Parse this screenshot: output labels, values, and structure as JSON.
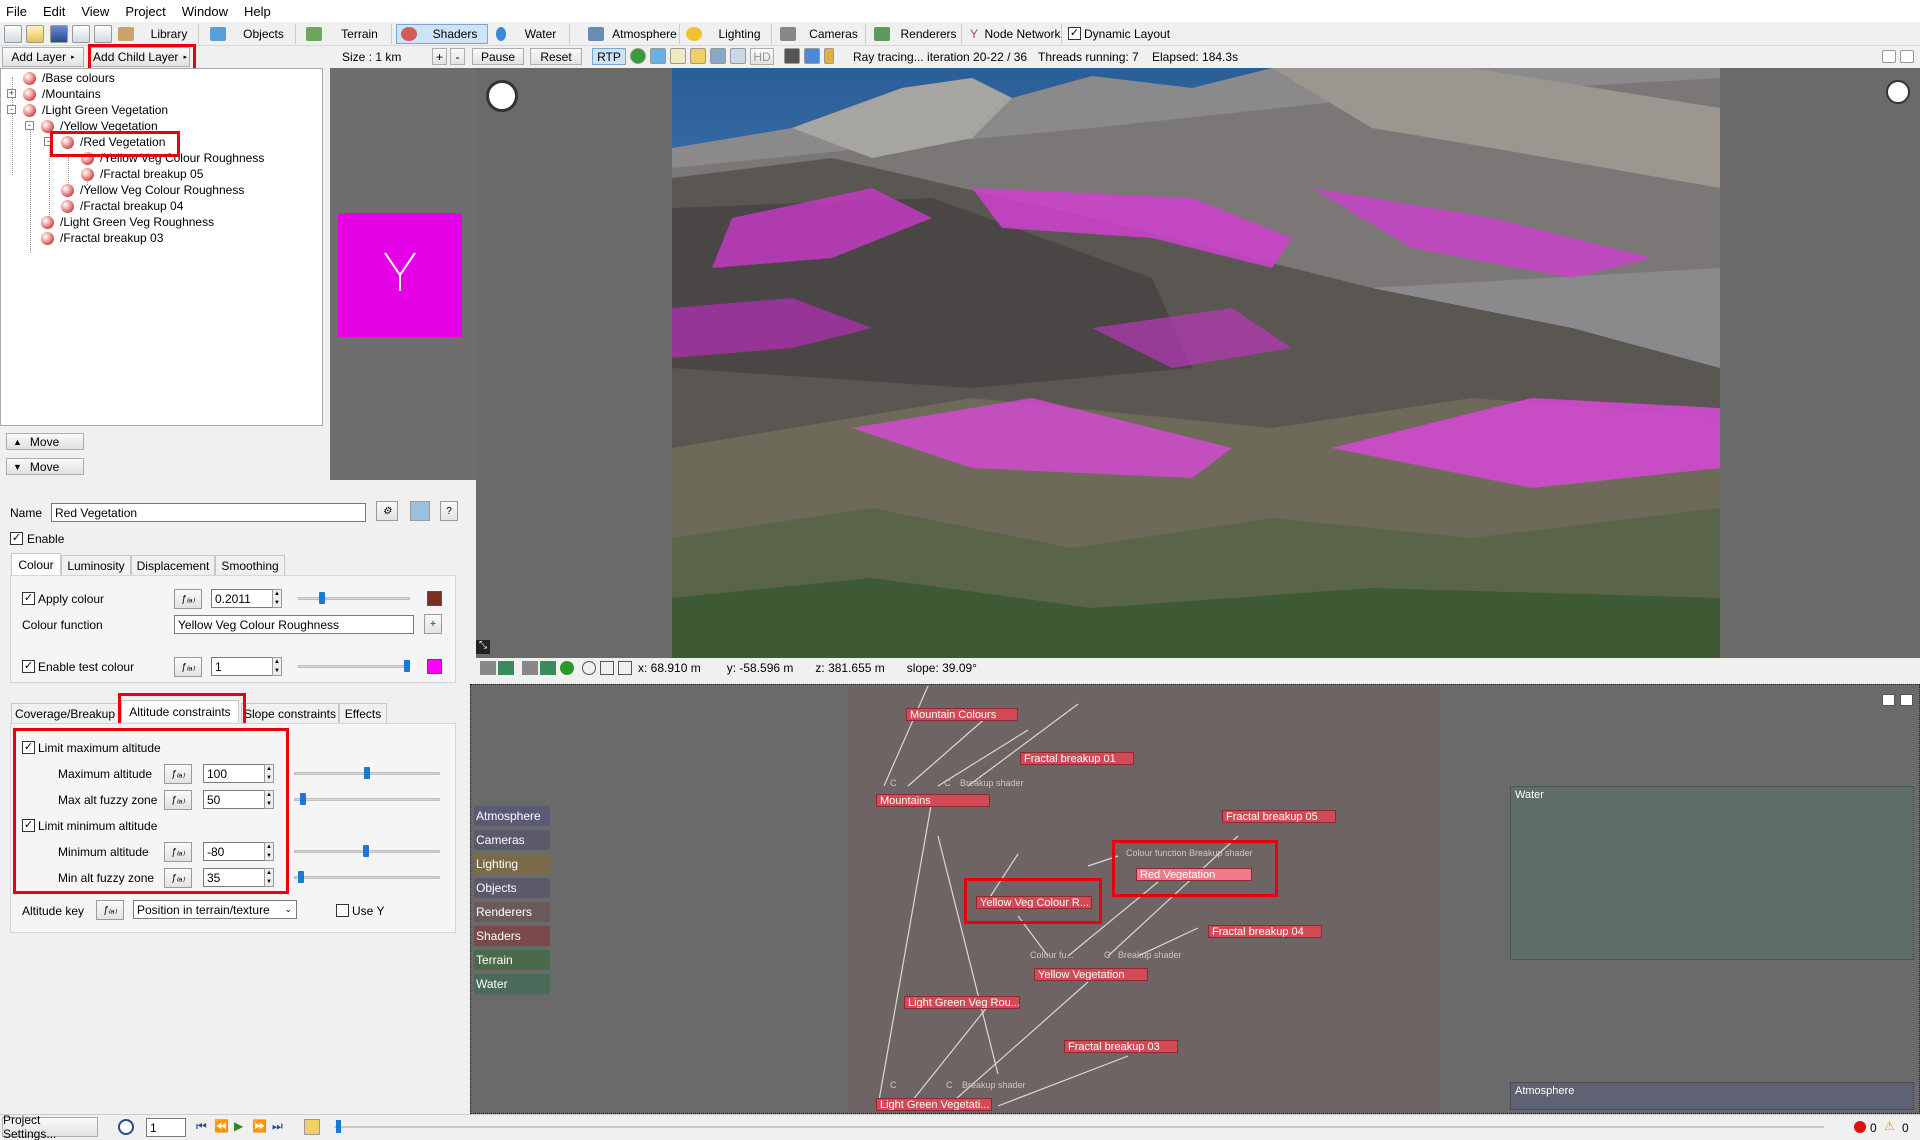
{
  "menu": [
    "File",
    "Edit",
    "View",
    "Project",
    "Window",
    "Help"
  ],
  "toolbar_tabs": [
    {
      "label": "Library",
      "icon": "library-icon",
      "color": "#c8a36a"
    },
    {
      "label": "Objects",
      "icon": "objects-icon",
      "color": "#5aa0d8"
    },
    {
      "label": "Terrain",
      "icon": "terrain-icon",
      "color": "#6aa85a"
    },
    {
      "label": "Shaders",
      "icon": "shaders-icon",
      "color": "#d45a5a"
    },
    {
      "label": "Water",
      "icon": "water-icon",
      "color": "#3a8ad8"
    },
    {
      "label": "Atmosphere",
      "icon": "atmosphere-icon",
      "color": "#6a8ab8"
    },
    {
      "label": "Lighting",
      "icon": "lighting-icon",
      "color": "#f0c030"
    },
    {
      "label": "Cameras",
      "icon": "cameras-icon",
      "color": "#888888"
    },
    {
      "label": "Renderers",
      "icon": "renderers-icon",
      "color": "#5a9a5a"
    },
    {
      "label": "Node Network",
      "icon": "node-network-icon",
      "color": "#c04040"
    }
  ],
  "dynamic_layout": {
    "label": "Dynamic Layout",
    "checked": true
  },
  "layer_toolbar": {
    "add_layer": "Add Layer",
    "add_child_layer": "Add Child Layer"
  },
  "render_toolbar": {
    "size_label": "Size : 1 km",
    "plus": "+",
    "minus": "-",
    "pause": "Pause",
    "reset": "Reset",
    "rtp": "RTP",
    "hd": "HD",
    "status": "Ray tracing... iteration 20-22 / 36",
    "threads": "Threads running: 7",
    "elapsed": "Elapsed: 184.3s"
  },
  "layer_tree": [
    {
      "label": "/Base colours"
    },
    {
      "label": "/Mountains",
      "expander": "+"
    },
    {
      "label": "/Light Green Vegetation",
      "expander": "-"
    },
    {
      "label": "/Yellow Vegetation",
      "expander": "-"
    },
    {
      "label": "/Red Vegetation",
      "expander": "-"
    },
    {
      "label": "/Yellow Veg Colour Roughness"
    },
    {
      "label": "/Fractal breakup 05"
    },
    {
      "label": "/Yellow Veg Colour Roughness"
    },
    {
      "label": "/Fractal breakup 04"
    },
    {
      "label": "/Light Green Veg Roughness"
    },
    {
      "label": "/Fractal breakup 03"
    }
  ],
  "move_buttons": {
    "up": "Move",
    "down": "Move"
  },
  "props": {
    "name_label": "Name",
    "name_value": "Red Vegetation",
    "enable_label": "Enable",
    "tabs_top": [
      "Colour",
      "Luminosity",
      "Displacement",
      "Smoothing"
    ],
    "apply_colour_label": "Apply colour",
    "apply_colour_value": "0.2011",
    "apply_colour_level": 0.2011,
    "apply_colour_swatch": "#7a3020",
    "colour_function_label": "Colour function",
    "colour_function_value": "Yellow Veg Colour Roughness",
    "enable_test_colour_label": "Enable test colour",
    "enable_test_colour_value": "1",
    "enable_test_colour_level": 1.0,
    "test_colour_swatch": "#ff00ff",
    "tabs_bottom": [
      "Coverage/Breakup",
      "Altitude constraints",
      "Slope constraints",
      "Effects"
    ],
    "limit_max_label": "Limit maximum altitude",
    "max_alt_label": "Maximum altitude",
    "max_alt_value": "100",
    "max_fuzzy_label": "Max alt fuzzy zone",
    "max_fuzzy_value": "50",
    "limit_min_label": "Limit minimum altitude",
    "min_alt_label": "Minimum altitude",
    "min_alt_value": "-80",
    "min_fuzzy_label": "Min alt fuzzy zone",
    "min_fuzzy_value": "35",
    "altitude_key_label": "Altitude key",
    "altitude_key_value": "Position in terrain/texture",
    "use_y_label": "Use Y"
  },
  "coords": {
    "x": "x: 68.910 m",
    "y": "y: -58.596 m",
    "z": "z: 381.655 m",
    "slope": "slope: 39.09°"
  },
  "node_categories": [
    {
      "label": "Atmosphere",
      "color": "#5a5a78"
    },
    {
      "label": "Cameras",
      "color": "#5a5a6a"
    },
    {
      "label": "Lighting",
      "color": "#7a6a4a"
    },
    {
      "label": "Objects",
      "color": "#5a5a6a"
    },
    {
      "label": "Renderers",
      "color": "#6a5a5a"
    },
    {
      "label": "Shaders",
      "color": "#7a4a4a"
    },
    {
      "label": "Terrain",
      "color": "#4a6a4a"
    },
    {
      "label": "Water",
      "color": "#4a6a5a"
    }
  ],
  "nodes": {
    "mountain_colours": "Mountain Colours",
    "fractal_breakup_01": "Fractal breakup 01",
    "mountains": "Mountains",
    "fractal_breakup_05": "Fractal breakup 05",
    "red_vegetation": "Red Vegetation",
    "yellow_veg_colour": "Yellow Veg Colour R...",
    "fractal_breakup_04": "Fractal breakup 04",
    "yellow_vegetation": "Yellow Vegetation",
    "light_green_veg_rou": "Light Green Veg Rou...",
    "fractal_breakup_03": "Fractal breakup 03",
    "light_green_vegetation": "Light Green Vegetati...",
    "sub_c": "C",
    "sub_breakup_shader": "Breakup shader",
    "sub_colour_fu": "Colour fu...",
    "sub_colour_breakup": "Colour function Breakup shader"
  },
  "network_panels": {
    "water": "Water",
    "atmosphere": "Atmosphere"
  },
  "bottom": {
    "project_settings": "Project Settings...",
    "frame": "1",
    "errors": "0",
    "warnings": "0"
  }
}
